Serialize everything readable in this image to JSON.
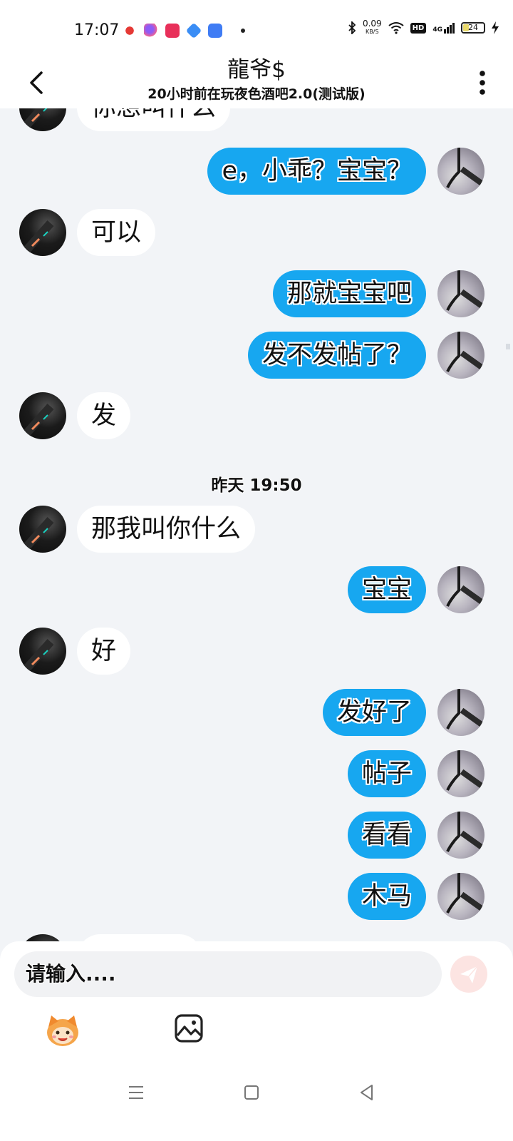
{
  "status_bar": {
    "time": "17:07",
    "net_speed_value": "0.09",
    "net_speed_unit": "KB/S",
    "network_type": "4G",
    "hd_badge": "HD",
    "battery_level": "24",
    "icons": [
      "app-notification-icon",
      "app-notification-icon",
      "video-app-icon",
      "app-notification-icon",
      "message-app-icon",
      "more-dot-icon",
      "bluetooth-icon",
      "wifi-icon",
      "signal-icon",
      "charging-icon"
    ]
  },
  "header": {
    "title": "龍爷$",
    "subtitle": "20小时前在玩夜色酒吧2.0(测试版)"
  },
  "messages": [
    {
      "side": "other",
      "text": "你想叫什么"
    },
    {
      "side": "self",
      "text": "e，小乖？宝宝？"
    },
    {
      "side": "other",
      "text": "可以"
    },
    {
      "side": "self",
      "text": "那就宝宝吧"
    },
    {
      "side": "self",
      "text": "发不发帖了？"
    },
    {
      "side": "other",
      "text": "发"
    },
    {
      "side": "self",
      "text": "宝宝"
    },
    {
      "side": "other",
      "text": "那我叫你什么"
    },
    {
      "side": "other",
      "text": "好"
    },
    {
      "side": "self",
      "text": "发好了"
    },
    {
      "side": "self",
      "text": "帖子"
    },
    {
      "side": "self",
      "text": "看看"
    },
    {
      "side": "self",
      "text": "木马"
    }
  ],
  "time_divider": "昨天 19:50",
  "input": {
    "placeholder": "请输入...."
  },
  "colors": {
    "self_bubble": "#17A7F0",
    "other_bubble": "#FFFFFF",
    "chat_background": "#F2F4F7",
    "send_button": "#FCE4E2"
  }
}
